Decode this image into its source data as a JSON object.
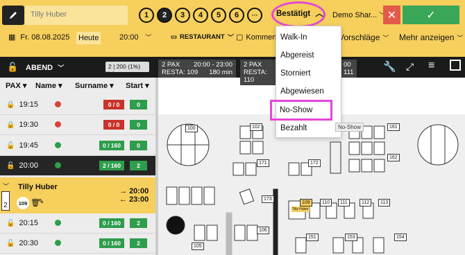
{
  "topbar": {
    "name_placeholder": "Tilly Huber",
    "party_sizes": [
      "1",
      "2",
      "3",
      "4",
      "5",
      "6",
      "···"
    ],
    "selected_party": "2",
    "status_label": "Bestätigt",
    "demo_label": "Demo Shar...",
    "close_symbol": "✕",
    "confirm_symbol": "✓"
  },
  "filters": {
    "date": "Fr. 08.08.2025",
    "today": "Heute",
    "time": "20:00",
    "area": "RESTAURANT",
    "comment": "Komment",
    "suggestions": "Vorschläge",
    "more": "Mehr anzeigen"
  },
  "darkbar": {
    "service": "ABEND",
    "capacity": "2 | 200 (1%)",
    "chip1_pax": "2 PAX",
    "chip1_time": "20:00 - 23:00",
    "chip1_resta": "RESTA: 109",
    "chip1_dur": "180 min",
    "chip2_pax": "2 PAX",
    "chip2_resta": "RESTA: 110",
    "chip3_time": "00",
    "chip3_num": "111"
  },
  "list": {
    "headers": [
      "PAX",
      "Name",
      "Surname",
      "Start"
    ],
    "rows": [
      {
        "time": "19:15",
        "dot": "#d9443a",
        "cap": "0 / 0",
        "cap_color": "red",
        "start": "0",
        "locked": true
      },
      {
        "time": "19:30",
        "dot": "#d9443a",
        "cap": "0 / 0",
        "cap_color": "red",
        "start": "0",
        "locked": true
      },
      {
        "time": "19:45",
        "dot": "#2e9d4c",
        "cap": "0 / 160",
        "cap_color": "green",
        "start": "0",
        "locked": false
      },
      {
        "time": "20:00",
        "dot": "#2e9d4c",
        "cap": "2 / 160",
        "cap_color": "green",
        "start": "2",
        "locked": false
      },
      {
        "time": "20:15",
        "dot": "#2e9d4c",
        "cap": "0 / 160",
        "cap_color": "green",
        "start": "2",
        "locked": false
      },
      {
        "time": "20:30",
        "dot": "#2e9d4c",
        "cap": "0 / 160",
        "cap_color": "green",
        "start": "2",
        "locked": false
      }
    ],
    "selected": {
      "name": "Tilly Huber",
      "pax": "2",
      "table": "109",
      "start": "20:00",
      "end": "23:00"
    }
  },
  "menu": {
    "items": [
      "Walk-In",
      "Abgereist",
      "Storniert",
      "Abgewiesen",
      "No-Show",
      "Bezahlt"
    ],
    "tooltip": "No-Show"
  },
  "floor": {
    "tables": [
      "100",
      "102",
      "161",
      "171",
      "172",
      "162",
      "173",
      "109",
      "110",
      "111",
      "112",
      "113",
      "106",
      "105",
      "151",
      "153",
      "154"
    ],
    "tag_text": "Tilly Huber"
  },
  "colors": {
    "yellow": "#f6cf5c",
    "dark": "#1b1b1b",
    "red": "#c8332b",
    "green": "#2e9d4c",
    "highlight": "#e545d8"
  }
}
